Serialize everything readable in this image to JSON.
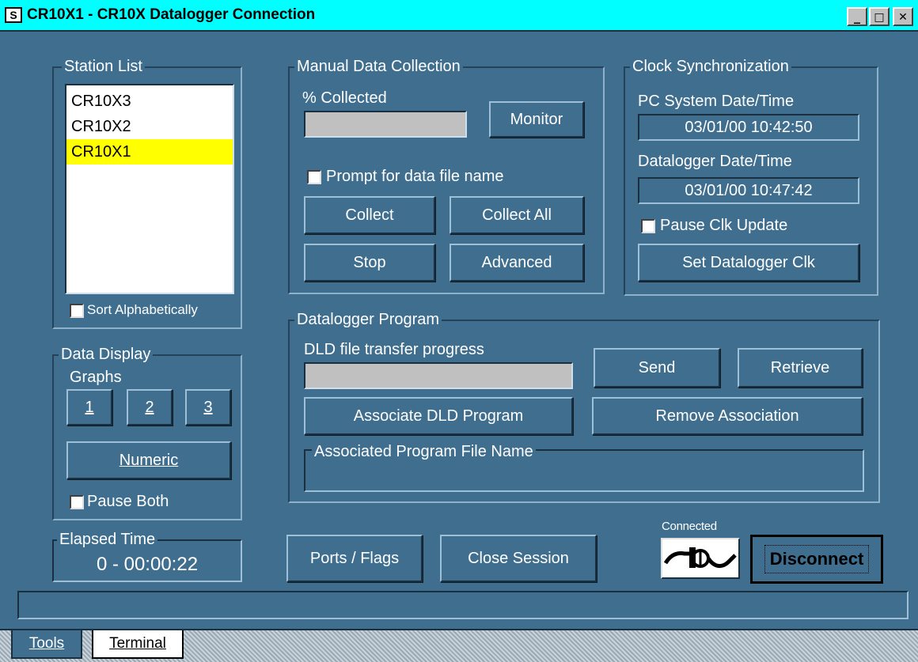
{
  "window": {
    "icon_text": "S",
    "title": "CR10X1 - CR10X Datalogger Connection",
    "minimize": "_",
    "maximize": "□",
    "close": "✕"
  },
  "station_list": {
    "label": "Station List",
    "items": [
      "CR10X3",
      "CR10X2",
      "CR10X1"
    ],
    "selected": "CR10X1",
    "sort_label": "Sort Alphabetically"
  },
  "data_display": {
    "label": "Data Display",
    "graphs_label": "Graphs",
    "graph_buttons": [
      "1",
      "2",
      "3"
    ],
    "numeric_label": "Numeric",
    "pause_both_label": "Pause Both"
  },
  "elapsed_time": {
    "label": "Elapsed Time",
    "value": "0 - 00:00:22"
  },
  "manual_collection": {
    "label": "Manual Data Collection",
    "percent_label": "% Collected",
    "monitor_label": "Monitor",
    "prompt_label": "Prompt for data file name",
    "collect_label": "Collect",
    "collect_all_label": "Collect All",
    "stop_label": "Stop",
    "advanced_label": "Advanced"
  },
  "clock_sync": {
    "label": "Clock Synchronization",
    "pc_label": "PC System Date/Time",
    "pc_value": "03/01/00 10:42:50",
    "dl_label": "Datalogger Date/Time",
    "dl_value": "03/01/00 10:47:42",
    "pause_label": "Pause Clk Update",
    "set_label": "Set Datalogger Clk"
  },
  "program": {
    "label": "Datalogger Program",
    "progress_label": "DLD file transfer progress",
    "send_label": "Send",
    "retrieve_label": "Retrieve",
    "associate_label": "Associate DLD Program",
    "remove_label": "Remove Association",
    "file_name_label": "Associated Program File Name",
    "file_name_value": ""
  },
  "bottom": {
    "ports_label": "Ports / Flags",
    "close_label": "Close Session",
    "connected_label": "Connected",
    "disconnect_label": "Disconnect"
  },
  "tabs": [
    "Tools",
    "Terminal"
  ],
  "colors": {
    "background": "#3f6e8f",
    "titlebar": "#00ffff",
    "selection": "#ffff00"
  }
}
